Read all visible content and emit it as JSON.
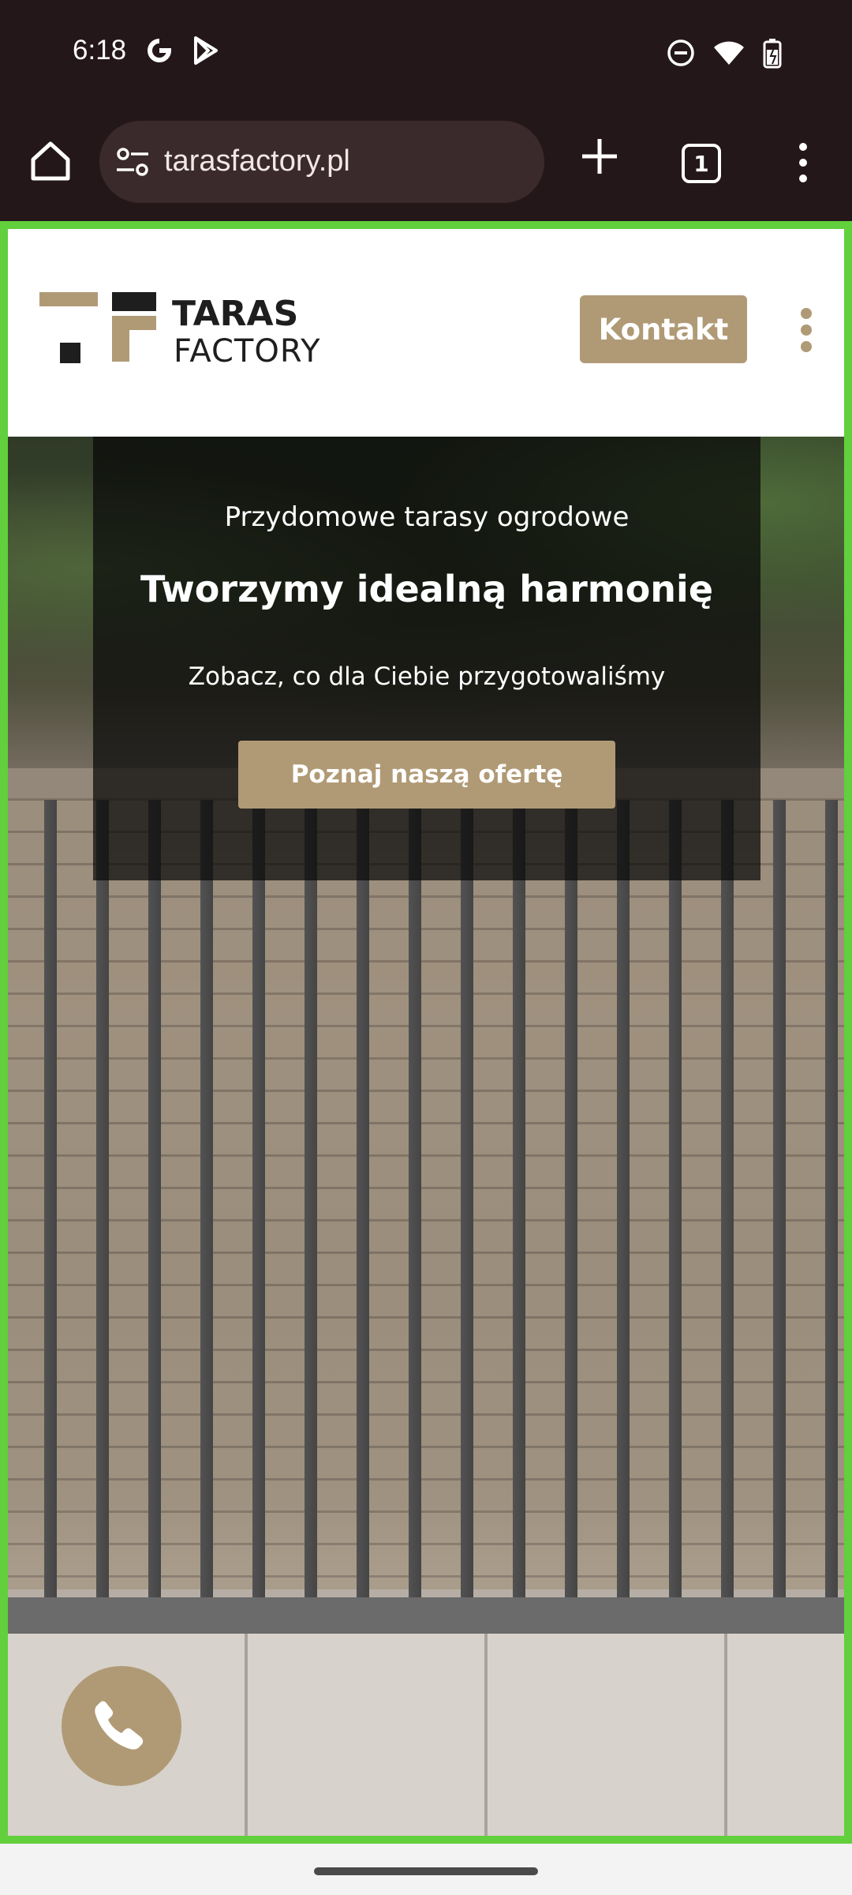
{
  "status_bar": {
    "time": "6:18",
    "icons": [
      "google-g-icon",
      "play-store-icon",
      "do-not-disturb-icon",
      "wifi-icon",
      "battery-icon"
    ]
  },
  "browser": {
    "url": "tarasfactory.pl",
    "tab_count": "1",
    "icons": [
      "home-icon",
      "site-settings-icon",
      "new-tab-icon",
      "tab-switcher-icon",
      "more-vert-icon"
    ]
  },
  "site": {
    "logo_alt": "TARAS FACTORY",
    "kontakt_label": "Kontakt",
    "accent": "#b09a76"
  },
  "hero": {
    "kicker": "Przydomowe tarasy ogrodowe",
    "title": "Tworzymy idealną harmonię",
    "subtitle": "Zobacz, co dla Ciebie przygotowaliśmy",
    "cta": "Poznaj naszą ofertę"
  },
  "fab": {
    "icon": "phone-icon"
  }
}
